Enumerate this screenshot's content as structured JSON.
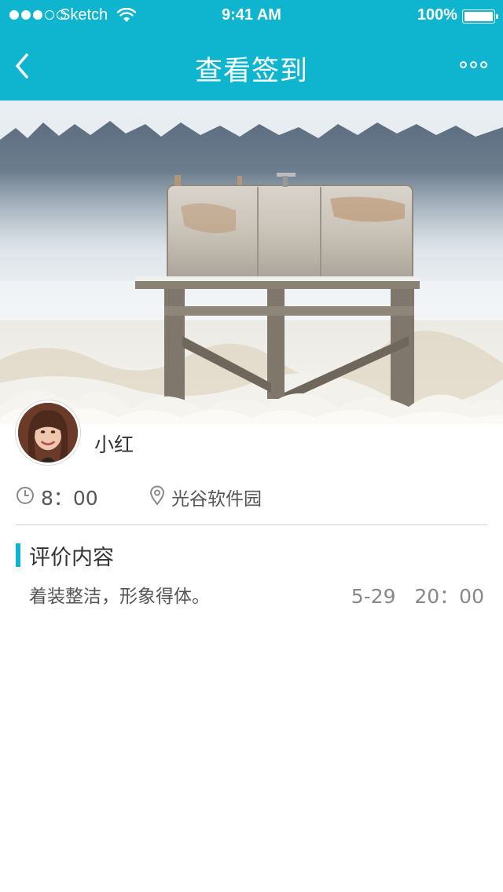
{
  "status_bar": {
    "carrier": "Sketch",
    "time": "9:41 AM",
    "battery": "100%"
  },
  "nav": {
    "title": "查看签到"
  },
  "user": {
    "name": "小红"
  },
  "checkin": {
    "time": "8：00",
    "location": "光谷软件园"
  },
  "evaluation": {
    "section_title": "评价内容",
    "comment": "着装整洁，形象得体。",
    "comment_time": "5-29   20：00"
  },
  "colors": {
    "accent": "#0fb4cf"
  }
}
